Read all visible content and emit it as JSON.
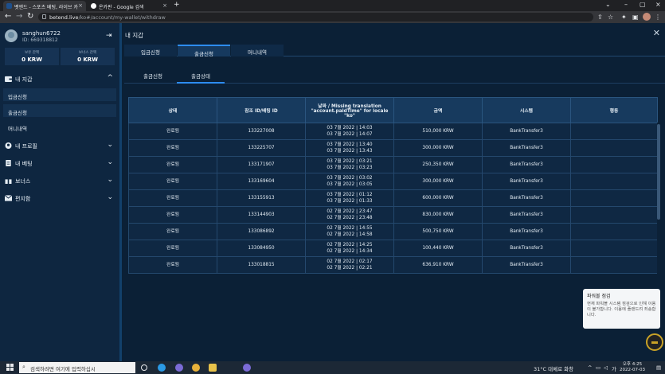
{
  "browser": {
    "tabs": [
      {
        "title": "벳엔드 - 스포츠 베팅, 라이브 카"
      },
      {
        "title": "온카판 - Google 검색"
      }
    ],
    "url_domain": "betend.live",
    "url_path": "/ko#/account/my-wallet/withdraw"
  },
  "sidebar": {
    "username": "sanghun6722",
    "user_id": "ID: 669318812",
    "balances": [
      {
        "label": "보유 잔액",
        "value": "0 KRW"
      },
      {
        "label": "보너스 잔액",
        "value": "0 KRW"
      }
    ],
    "sections": [
      {
        "label": "내 지갑",
        "icon": "wallet-icon",
        "chevron": "^"
      },
      {
        "label": "내 프로필",
        "icon": "user-icon",
        "chevron": "⌄"
      },
      {
        "label": "내 베팅",
        "icon": "bets-icon",
        "chevron": "⌄"
      },
      {
        "label": "보너스",
        "icon": "gift-icon",
        "chevron": "⌄"
      },
      {
        "label": "편지함",
        "icon": "mail-icon",
        "chevron": "⌄"
      }
    ],
    "wallet_items": [
      {
        "label": "입금신청"
      },
      {
        "label": "출금신청"
      },
      {
        "label": "머니내역"
      }
    ]
  },
  "main": {
    "title": "내 지갑",
    "tabs": [
      {
        "label": "입금신청"
      },
      {
        "label": "출금신청"
      },
      {
        "label": "머니내역"
      }
    ],
    "subtabs": [
      {
        "label": "출금신청"
      },
      {
        "label": "출금상태"
      }
    ],
    "table": {
      "headers": [
        "상태",
        "참조 ID/배팅 ID",
        "날짜 / Missing translation \"account.paidTime\" for locale \"ko\"",
        "금액",
        "시스템",
        "행동"
      ],
      "rows": [
        {
          "status": "완료됨",
          "ref": "133227008",
          "date1": "03 7월 2022 | 14:03",
          "date2": "03 7월 2022 | 14:07",
          "amount": "510,000 KRW",
          "system": "BankTransfer3",
          "action": ""
        },
        {
          "status": "완료됨",
          "ref": "133225707",
          "date1": "03 7월 2022 | 13:40",
          "date2": "03 7월 2022 | 13:43",
          "amount": "300,000 KRW",
          "system": "BankTransfer3",
          "action": ""
        },
        {
          "status": "완료됨",
          "ref": "133171907",
          "date1": "03 7월 2022 | 03:21",
          "date2": "03 7월 2022 | 03:23",
          "amount": "250,350 KRW",
          "system": "BankTransfer3",
          "action": ""
        },
        {
          "status": "완료됨",
          "ref": "133169604",
          "date1": "03 7월 2022 | 03:02",
          "date2": "03 7월 2022 | 03:05",
          "amount": "300,000 KRW",
          "system": "BankTransfer3",
          "action": ""
        },
        {
          "status": "완료됨",
          "ref": "133155913",
          "date1": "03 7월 2022 | 01:12",
          "date2": "03 7월 2022 | 01:33",
          "amount": "600,000 KRW",
          "system": "BankTransfer3",
          "action": ""
        },
        {
          "status": "완료됨",
          "ref": "133144903",
          "date1": "02 7월 2022 | 23:47",
          "date2": "02 7월 2022 | 23:48",
          "amount": "830,000 KRW",
          "system": "BankTransfer3",
          "action": ""
        },
        {
          "status": "완료됨",
          "ref": "133086892",
          "date1": "02 7월 2022 | 14:55",
          "date2": "02 7월 2022 | 14:58",
          "amount": "500,750 KRW",
          "system": "BankTransfer3",
          "action": ""
        },
        {
          "status": "완료됨",
          "ref": "133084950",
          "date1": "02 7월 2022 | 14:25",
          "date2": "02 7월 2022 | 14:34",
          "amount": "100,440 KRW",
          "system": "BankTransfer3",
          "action": ""
        },
        {
          "status": "완료됨",
          "ref": "133018815",
          "date1": "02 7월 2022 | 02:17",
          "date2": "02 7월 2022 | 02:21",
          "amount": "636,910 KRW",
          "system": "BankTransfer3",
          "action": ""
        }
      ]
    }
  },
  "toast": {
    "title": "파워볼 점검",
    "body": "현재 파워볼 시스템 점검으로 인해 이용이 불가합니다. 이용에 플랜드려 죄송합니다."
  },
  "taskbar": {
    "search_placeholder": "검색하려면 여기에 입력하십시",
    "weather": "31°C 대체로 화창",
    "time": "오후 4:25",
    "date": "2022-07-03"
  },
  "colors": {
    "accent": "#2d8cf0",
    "page_bg": "#0b2036",
    "sidebar_bg": "#0e2640"
  }
}
